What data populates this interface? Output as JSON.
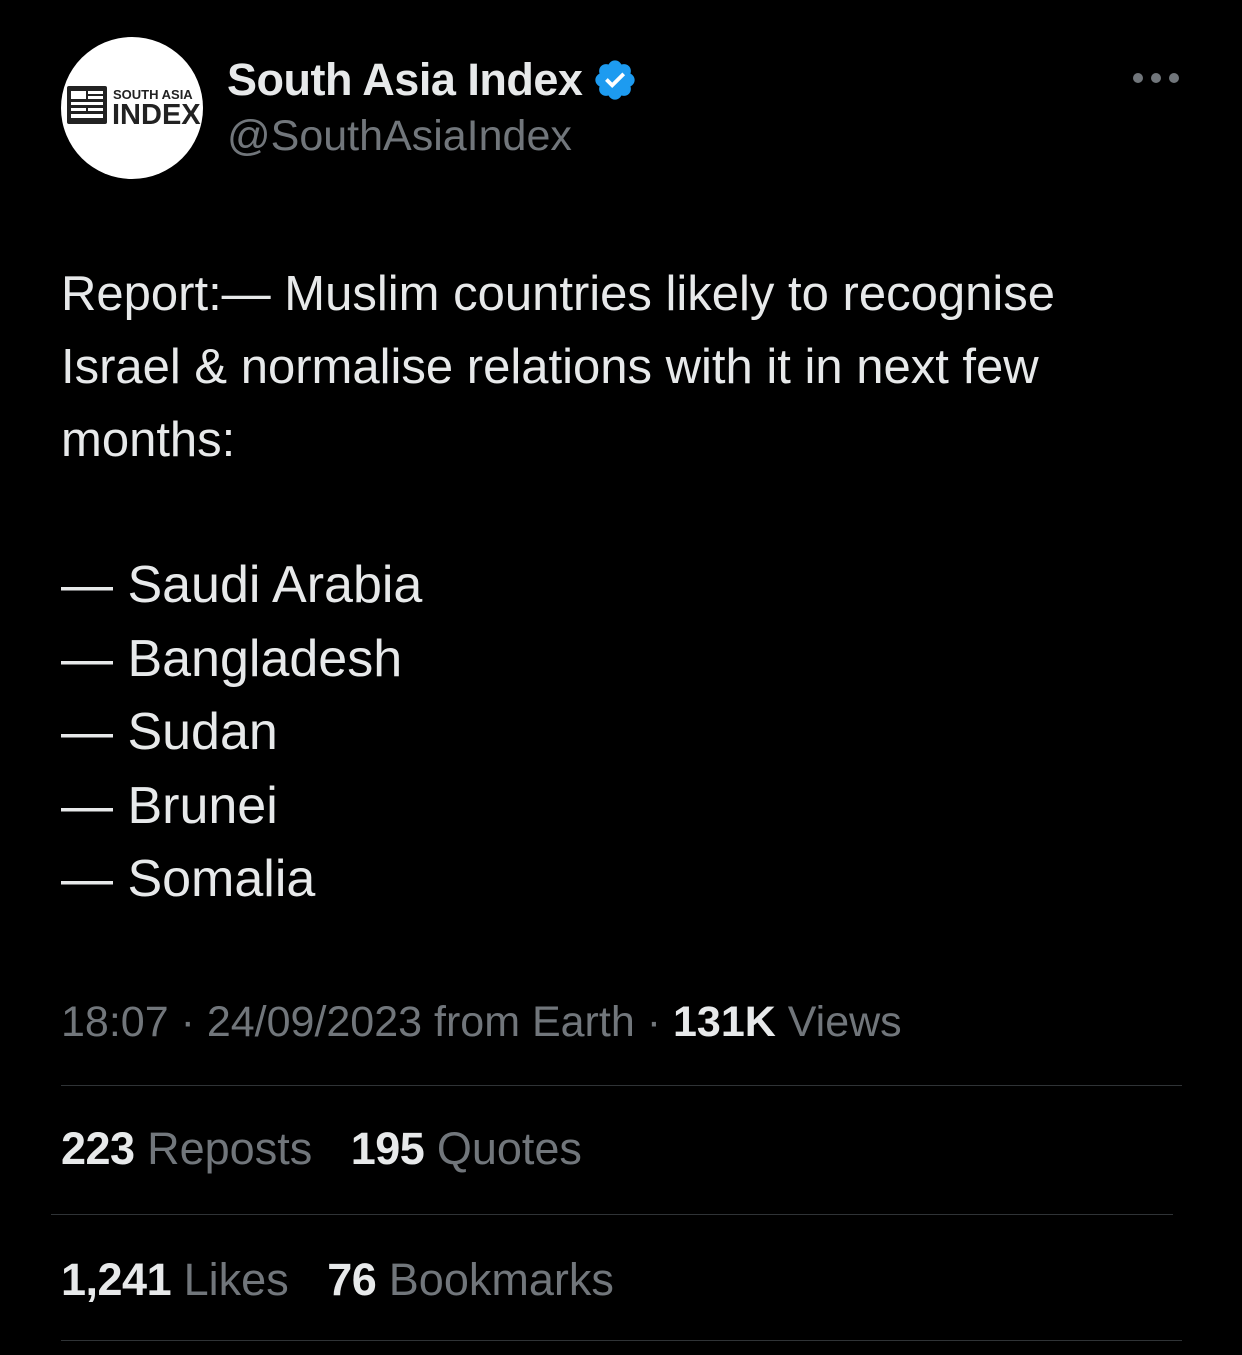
{
  "account": {
    "display_name": "South Asia Index",
    "handle": "@SouthAsiaIndex",
    "verified": true,
    "avatar_logo_text_top": "SOUTH ASIA",
    "avatar_logo_text_bottom": "INDEX"
  },
  "tweet": {
    "lines": [
      "Report:— Muslim countries likely to recognise",
      "Israel & normalise relations with it in next few",
      "months:"
    ],
    "list": [
      "— Saudi Arabia",
      "— Bangladesh",
      "— Sudan",
      "— Brunei",
      "— Somalia"
    ]
  },
  "meta": {
    "time": "18:07",
    "date": "24/09/2023",
    "source": "from Earth",
    "separator": "·",
    "views_count": "131K",
    "views_label": "Views"
  },
  "engagement": {
    "reposts_count": "223",
    "reposts_label": "Reposts",
    "quotes_count": "195",
    "quotes_label": "Quotes",
    "likes_count": "1,241",
    "likes_label": "Likes",
    "bookmarks_count": "76",
    "bookmarks_label": "Bookmarks"
  },
  "colors": {
    "background": "#000000",
    "primary_text": "#e7e9ea",
    "secondary_text": "#71767b",
    "verified_badge": "#1d9bf0",
    "divider": "#2f3336"
  },
  "icons": {
    "verified": "verified-badge-icon",
    "more": "more-horizontal-icon"
  }
}
